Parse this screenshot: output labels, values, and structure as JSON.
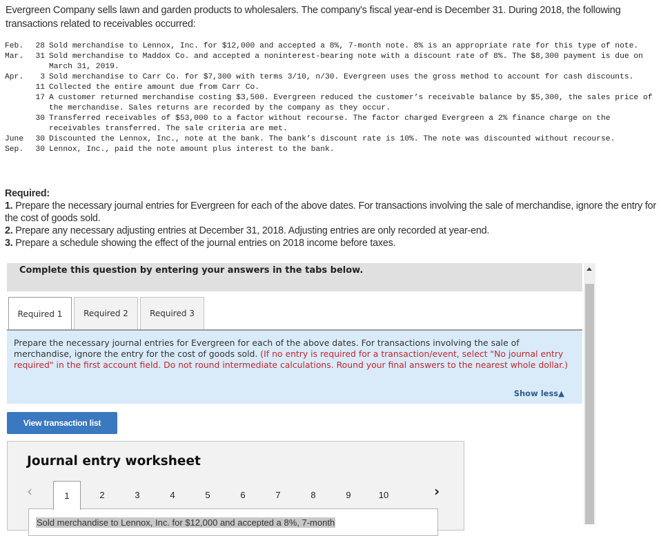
{
  "intro": "Evergreen Company sells lawn and garden products to wholesalers. The company's fiscal year-end is December 31. During 2018, the following transactions related to receivables occurred:",
  "transactions": [
    {
      "month": "Feb.",
      "day": "28",
      "text": "Sold merchandise to Lennox, Inc. for $12,000 and accepted a 8%, 7-month note. 8% is an appropriate rate for this type of note."
    },
    {
      "month": "Mar.",
      "day": "31",
      "text": "Sold merchandise to Maddox Co. and accepted a noninterest-bearing note with a discount rate of 8%. The $8,300 payment is due on March 31, 2019."
    },
    {
      "month": "Apr.",
      "day": "3",
      "text": "Sold merchandise to Carr Co. for $7,300 with terms 3/10, n/30. Evergreen uses the gross method to account for cash discounts."
    },
    {
      "month": "",
      "day": "11",
      "text": "Collected the entire amount due from Carr Co."
    },
    {
      "month": "",
      "day": "17",
      "text": "A customer returned merchandise costing $3,500. Evergreen reduced the customer’s receivable balance by $5,300, the sales price of the merchandise. Sales returns are recorded by the company as they occur."
    },
    {
      "month": "",
      "day": "30",
      "text": "Transferred receivables of $53,000 to a factor without recourse. The factor charged Evergreen a 2% finance charge on the receivables transferred. The sale criteria are met."
    },
    {
      "month": "June",
      "day": "30",
      "text": "Discounted the Lennox, Inc., note at the bank. The bank’s discount rate is 10%. The note was discounted without recourse."
    },
    {
      "month": "Sep.",
      "day": "30",
      "text": "Lennox, Inc., paid the note amount plus interest to the bank."
    }
  ],
  "required": {
    "heading": "Required:",
    "items": [
      {
        "num": "1.",
        "text": " Prepare the necessary journal entries for Evergreen for each of the above dates. For transactions involving the sale of merchandise, ignore the entry for the cost of goods sold."
      },
      {
        "num": "2.",
        "text": " Prepare any necessary adjusting entries at December 31, 2018. Adjusting entries are only recorded at year-end."
      },
      {
        "num": "3.",
        "text": " Prepare a schedule showing the effect of the journal entries on 2018 income before taxes."
      }
    ]
  },
  "panel": {
    "header": "Complete this question by entering your answers in the tabs below.",
    "tabs": [
      {
        "label": "Required 1",
        "active": true
      },
      {
        "label": "Required 2",
        "active": false
      },
      {
        "label": "Required 3",
        "active": false
      }
    ],
    "instructions": "Prepare the necessary journal entries for Evergreen for each of the above dates. For transactions involving the sale of merchandise, ignore the entry for the cost of goods sold. ",
    "instructions_note": "(If no entry is required for a transaction/event, select \"No journal entry required\" in the first account field. Do not round intermediate calculations. Round your final answers to the nearest whole dollar.)",
    "show_less": "Show less"
  },
  "view_transaction_button": "View transaction list",
  "worksheet": {
    "title": "Journal entry worksheet",
    "pages": [
      "1",
      "2",
      "3",
      "4",
      "5",
      "6",
      "7",
      "8",
      "9",
      "10"
    ],
    "active_page": "1",
    "entry_description": "Sold merchandise to Lennox, Inc. for $12,000 and accepted a 8%, 7-month"
  }
}
